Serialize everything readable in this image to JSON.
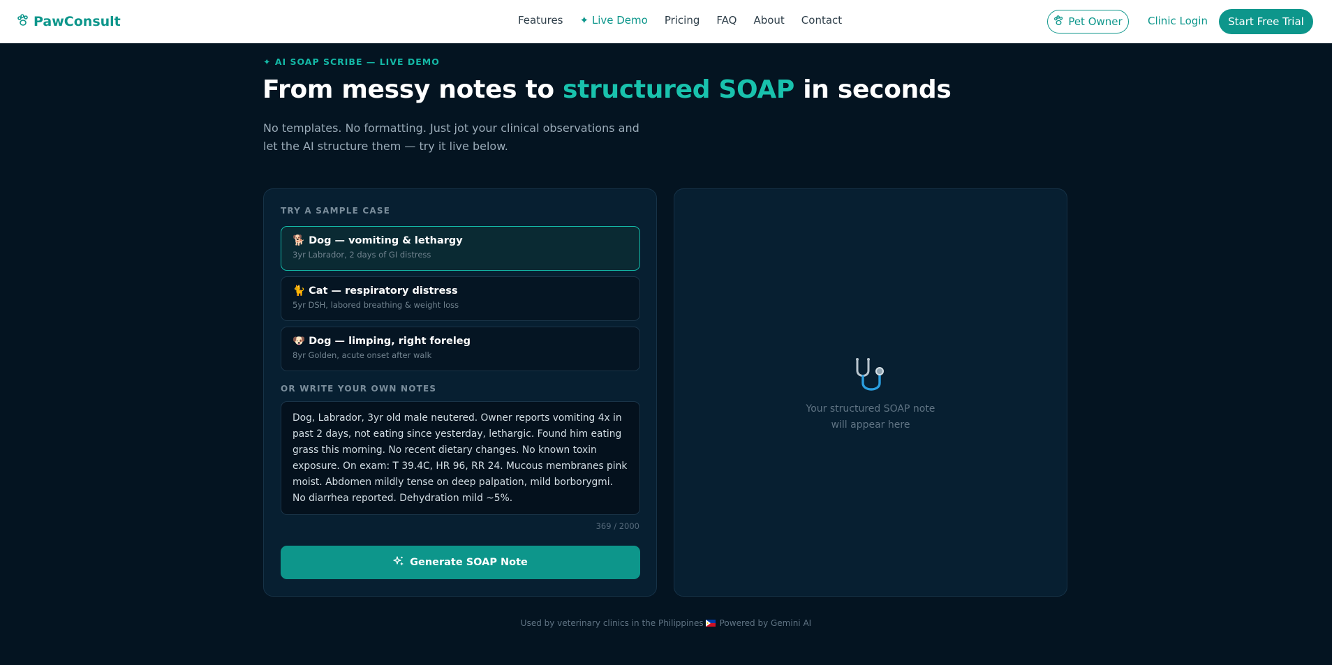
{
  "nav": {
    "brand": "PawConsult",
    "links": [
      "Features",
      "✦ Live Demo",
      "Pricing",
      "FAQ",
      "About",
      "Contact"
    ],
    "pet_owner": "Pet Owner",
    "clinic_login": "Clinic Login",
    "trial": "Start Free Trial"
  },
  "hero": {
    "eyebrow": "✦ AI SOAP SCRIBE — LIVE DEMO",
    "headline_pre": "From messy notes to ",
    "headline_accent": "structured SOAP",
    "headline_post": " in seconds",
    "subtitle": "No templates. No formatting. Just jot your clinical observations and let the AI structure them — try it live below."
  },
  "samples": {
    "label": "TRY A SAMPLE CASE",
    "cases": [
      {
        "emoji": "🐕",
        "title": "Dog — vomiting & lethargy",
        "sub": "3yr Labrador, 2 days of GI distress"
      },
      {
        "emoji": "🐈",
        "title": "Cat — respiratory distress",
        "sub": "5yr DSH, labored breathing & weight loss"
      },
      {
        "emoji": "🐶",
        "title": "Dog — limping, right foreleg",
        "sub": "8yr Golden, acute onset after walk"
      }
    ]
  },
  "notes": {
    "label": "OR WRITE YOUR OWN NOTES",
    "value": "Dog, Labrador, 3yr old male neutered. Owner reports vomiting 4x in past 2 days, not eating since yesterday, lethargic. Found him eating grass this morning. No recent dietary changes. No known toxin exposure. On exam: T 39.4C, HR 96, RR 24. Mucous membranes pink moist. Abdomen mildly tense on deep palpation, mild borborygmi. No diarrhea reported. Dehydration mild ~5%.",
    "counter": "369 / 2000"
  },
  "generate": {
    "label": "Generate SOAP Note"
  },
  "output": {
    "placeholder": "Your structured SOAP note will appear here"
  },
  "footer": {
    "left": "Used by veterinary clinics in the Philippines",
    "right": "Powered by Gemini AI"
  },
  "colors": {
    "accent": "#0d968b",
    "accent_bright": "#19c2ad",
    "bg": "#041421",
    "panel": "#071f31"
  },
  "icons": {
    "logo": "paw-icon",
    "pet_owner": "paw-icon",
    "generate": "sparkles-icon",
    "output": "stethoscope-icon",
    "footer": "philippines-flag-icon"
  }
}
